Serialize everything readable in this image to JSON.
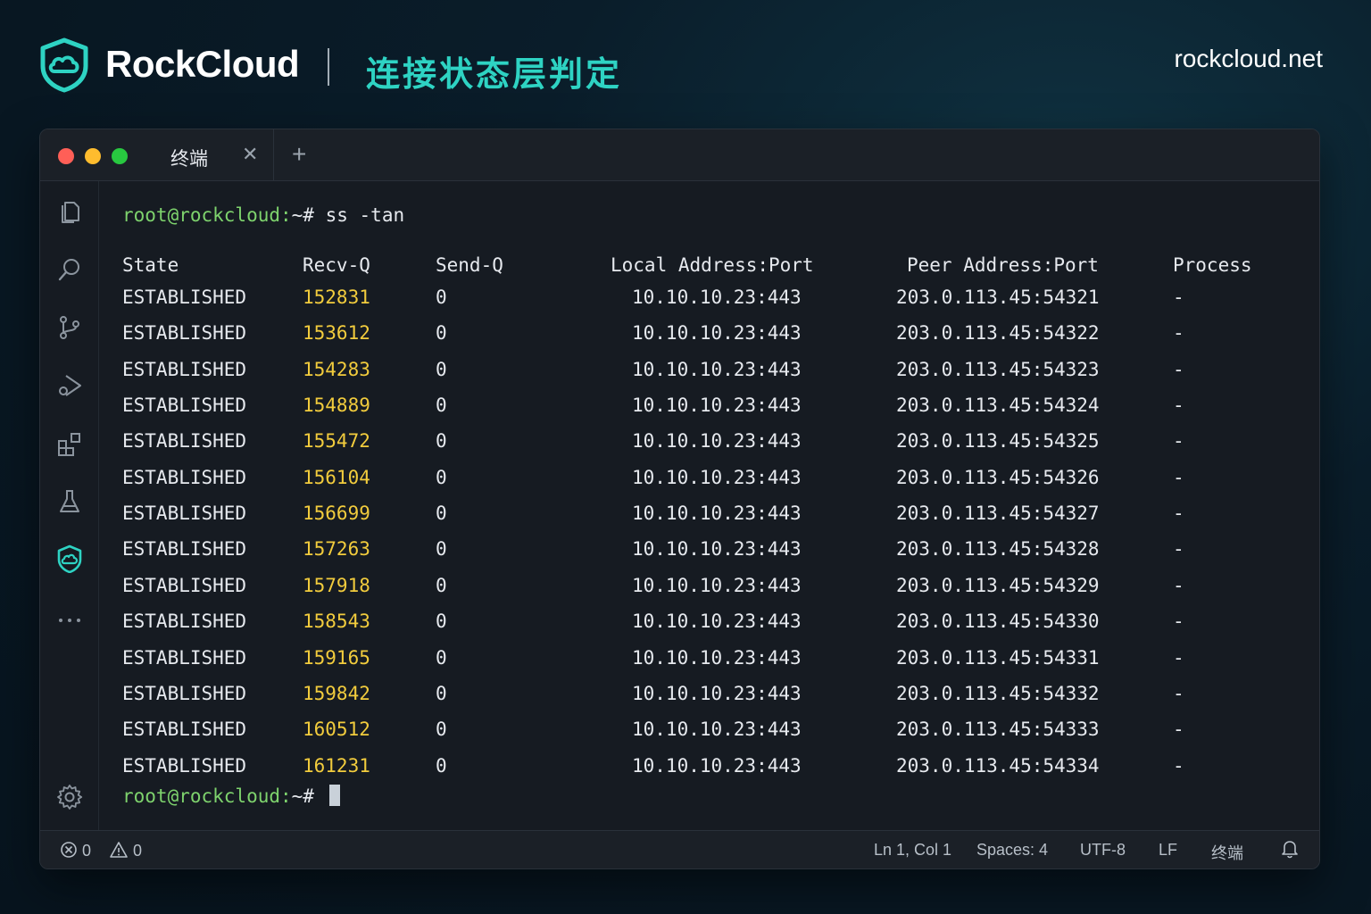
{
  "brand": {
    "name": "RockCloud",
    "subtitle": "连接状态层判定",
    "site": "rockcloud.net"
  },
  "window": {
    "tabs": [
      {
        "label": "终端"
      }
    ]
  },
  "activity_icons": [
    "files-icon",
    "search-icon",
    "source-control-icon",
    "run-debug-icon",
    "extensions-icon",
    "testing-icon",
    "rockcloud-shield-icon",
    "more-icon",
    "settings-icon"
  ],
  "terminal": {
    "prompt_user": "root@rockcloud:",
    "prompt_tail": "~#",
    "command": "ss -tan",
    "headers": {
      "state": "State",
      "recv": "Recv-Q",
      "send": "Send-Q",
      "local": "Local Address:Port",
      "peer": "Peer Address:Port",
      "process": "Process"
    },
    "rows": [
      {
        "state": "ESTABLISHED",
        "recv": "152831",
        "send": "0",
        "local": "10.10.10.23:443",
        "peer": "203.0.113.45:54321",
        "process": "-"
      },
      {
        "state": "ESTABLISHED",
        "recv": "153612",
        "send": "0",
        "local": "10.10.10.23:443",
        "peer": "203.0.113.45:54322",
        "process": "-"
      },
      {
        "state": "ESTABLISHED",
        "recv": "154283",
        "send": "0",
        "local": "10.10.10.23:443",
        "peer": "203.0.113.45:54323",
        "process": "-"
      },
      {
        "state": "ESTABLISHED",
        "recv": "154889",
        "send": "0",
        "local": "10.10.10.23:443",
        "peer": "203.0.113.45:54324",
        "process": "-"
      },
      {
        "state": "ESTABLISHED",
        "recv": "155472",
        "send": "0",
        "local": "10.10.10.23:443",
        "peer": "203.0.113.45:54325",
        "process": "-"
      },
      {
        "state": "ESTABLISHED",
        "recv": "156104",
        "send": "0",
        "local": "10.10.10.23:443",
        "peer": "203.0.113.45:54326",
        "process": "-"
      },
      {
        "state": "ESTABLISHED",
        "recv": "156699",
        "send": "0",
        "local": "10.10.10.23:443",
        "peer": "203.0.113.45:54327",
        "process": "-"
      },
      {
        "state": "ESTABLISHED",
        "recv": "157263",
        "send": "0",
        "local": "10.10.10.23:443",
        "peer": "203.0.113.45:54328",
        "process": "-"
      },
      {
        "state": "ESTABLISHED",
        "recv": "157918",
        "send": "0",
        "local": "10.10.10.23:443",
        "peer": "203.0.113.45:54329",
        "process": "-"
      },
      {
        "state": "ESTABLISHED",
        "recv": "158543",
        "send": "0",
        "local": "10.10.10.23:443",
        "peer": "203.0.113.45:54330",
        "process": "-"
      },
      {
        "state": "ESTABLISHED",
        "recv": "159165",
        "send": "0",
        "local": "10.10.10.23:443",
        "peer": "203.0.113.45:54331",
        "process": "-"
      },
      {
        "state": "ESTABLISHED",
        "recv": "159842",
        "send": "0",
        "local": "10.10.10.23:443",
        "peer": "203.0.113.45:54332",
        "process": "-"
      },
      {
        "state": "ESTABLISHED",
        "recv": "160512",
        "send": "0",
        "local": "10.10.10.23:443",
        "peer": "203.0.113.45:54333",
        "process": "-"
      },
      {
        "state": "ESTABLISHED",
        "recv": "161231",
        "send": "0",
        "local": "10.10.10.23:443",
        "peer": "203.0.113.45:54334",
        "process": "-"
      }
    ]
  },
  "statusbar": {
    "errors": "0",
    "warnings": "0",
    "position": "Ln 1, Col 1",
    "spaces": "Spaces: 4",
    "encoding": "UTF-8",
    "eol": "LF",
    "mode": "终端"
  },
  "colors": {
    "accent": "#2ed3c3",
    "prompt": "#7ed36d",
    "recv_q": "#f2cc3d"
  }
}
